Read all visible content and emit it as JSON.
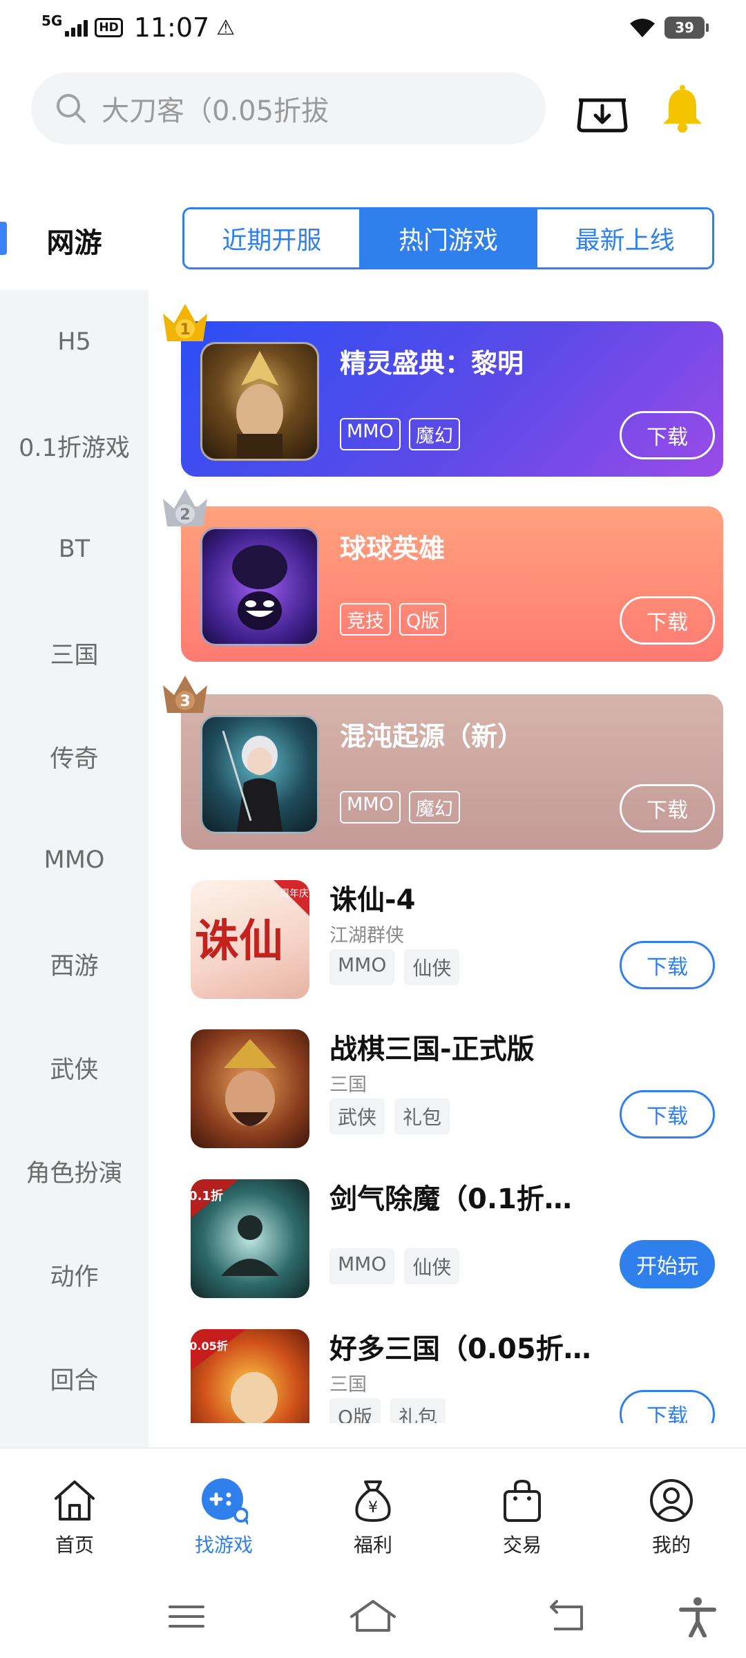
{
  "status_bar": {
    "network": "5G",
    "hd": "HD",
    "time": "11:07",
    "battery": "39"
  },
  "search": {
    "placeholder": "大刀客（0.05折拔"
  },
  "category": {
    "active": "网游"
  },
  "tabs": [
    {
      "label": "近期开服",
      "active": false
    },
    {
      "label": "热门游戏",
      "active": true
    },
    {
      "label": "最新上线",
      "active": false
    }
  ],
  "sidebar": [
    "H5",
    "0.1折游戏",
    "BT",
    "三国",
    "传奇",
    "MMO",
    "西游",
    "武侠",
    "角色扮演",
    "动作",
    "回合"
  ],
  "featured": [
    {
      "rank": "1",
      "title": "精灵盛典：黎明",
      "tags": [
        "MMO",
        "魔幻"
      ],
      "button": "下载"
    },
    {
      "rank": "2",
      "title": "球球英雄",
      "tags": [
        "竞技",
        "Q版"
      ],
      "button": "下载"
    },
    {
      "rank": "3",
      "title": "混沌起源（新）",
      "tags": [
        "MMO",
        "魔幻"
      ],
      "button": "下载"
    }
  ],
  "list": [
    {
      "name": "诛仙-4",
      "sub": "江湖群侠",
      "tags": [
        "MMO",
        "仙侠"
      ],
      "button": "下载",
      "thumb_text": "诛仙",
      "thumb_badge": "周年庆"
    },
    {
      "name": "战棋三国-正式版",
      "sub": "三国",
      "tags": [
        "武侠",
        "礼包"
      ],
      "button": "下载"
    },
    {
      "name": "剑气除魔（0.1折…",
      "sub": "",
      "tags": [
        "MMO",
        "仙侠"
      ],
      "button": "开始玩",
      "thumb_badge": "0.1折"
    },
    {
      "name": "好多三国（0.05折…",
      "sub": "三国",
      "tags": [
        "Q版",
        "礼包"
      ],
      "button": "下载",
      "thumb_badge": "0.05折"
    }
  ],
  "bottom_nav": [
    {
      "label": "首页",
      "icon": "home-icon",
      "active": false
    },
    {
      "label": "找游戏",
      "icon": "find-game-icon",
      "active": true
    },
    {
      "label": "福利",
      "icon": "money-bag-icon",
      "active": false
    },
    {
      "label": "交易",
      "icon": "shopping-bag-icon",
      "active": false
    },
    {
      "label": "我的",
      "icon": "profile-icon",
      "active": false
    }
  ],
  "colors": {
    "accent": "#2f80ed",
    "sidebar_bg": "#f3f4f5",
    "bell": "#f5c400"
  }
}
